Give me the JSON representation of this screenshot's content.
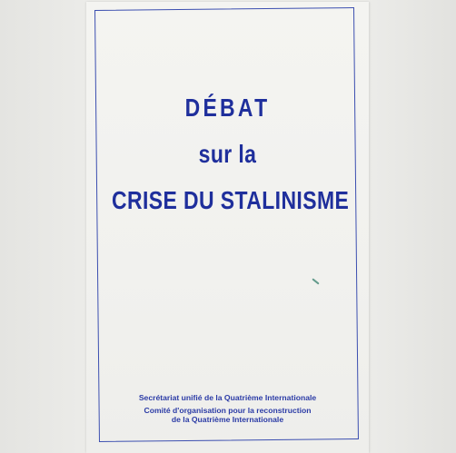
{
  "cover": {
    "title_line1": "DÉBAT",
    "title_line2": "sur la",
    "title_line3": "CRISE DU STALINISME",
    "publisher_1": "Secrétariat unifié de la Quatrième Internationale",
    "publisher_2_line1": "Comité d'organisation pour la reconstruction",
    "publisher_2_line2": "de la Quatrième Internationale"
  },
  "colors": {
    "ink": "#1f2f9c",
    "paper": "#f2f2ef"
  }
}
